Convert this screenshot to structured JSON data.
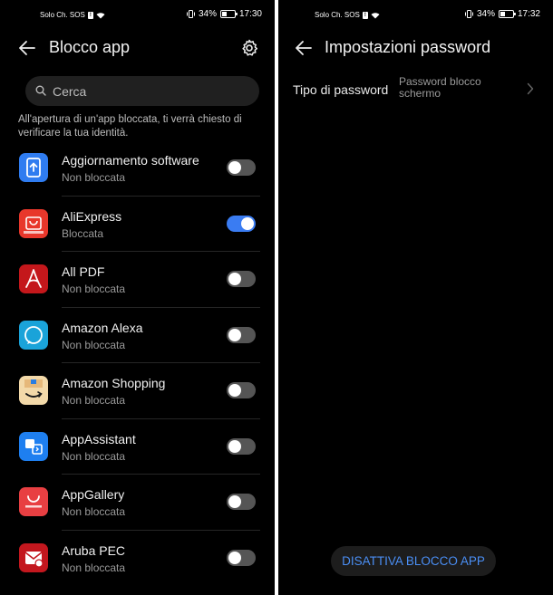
{
  "left": {
    "status": {
      "carrier": "Solo Ch. SOS",
      "sos_badge": "!",
      "battery": "34%",
      "time": "17:30"
    },
    "title": "Blocco app",
    "search": {
      "placeholder": "Cerca",
      "value": ""
    },
    "hint": "All'apertura di un'app bloccata, ti verrà chiesto di verificare la tua identità.",
    "apps": [
      {
        "name": "Aggiornamento software",
        "state": "Non bloccata",
        "locked": false,
        "icon": "software-update-icon",
        "color": "#2f7cf0"
      },
      {
        "name": "AliExpress",
        "state": "Bloccata",
        "locked": true,
        "icon": "aliexpress-icon",
        "color": "#e8372b"
      },
      {
        "name": "All PDF",
        "state": "Non bloccata",
        "locked": false,
        "icon": "pdf-icon",
        "color": "#c4171b"
      },
      {
        "name": "Amazon Alexa",
        "state": "Non bloccata",
        "locked": false,
        "icon": "alexa-icon",
        "color": "#1aa3d9"
      },
      {
        "name": "Amazon Shopping",
        "state": "Non bloccata",
        "locked": false,
        "icon": "amazon-shopping-icon",
        "color": "#f3d9a9"
      },
      {
        "name": "AppAssistant",
        "state": "Non bloccata",
        "locked": false,
        "icon": "app-assistant-icon",
        "color": "#1e7ff0"
      },
      {
        "name": "AppGallery",
        "state": "Non bloccata",
        "locked": false,
        "icon": "appgallery-icon",
        "color": "#e83f42"
      },
      {
        "name": "Aruba PEC",
        "state": "Non bloccata",
        "locked": false,
        "icon": "aruba-pec-icon",
        "color": "#c3171e"
      }
    ]
  },
  "right": {
    "status": {
      "carrier": "Solo Ch. SOS",
      "sos_badge": "!",
      "battery": "34%",
      "time": "17:32"
    },
    "title": "Impostazioni password",
    "password_type": {
      "label": "Tipo di password",
      "value": "Password blocco schermo"
    },
    "disable_button": "DISATTIVA BLOCCO APP"
  },
  "colors": {
    "accent": "#3a7cf2",
    "button_text": "#4a8ef4",
    "background": "#000000"
  }
}
